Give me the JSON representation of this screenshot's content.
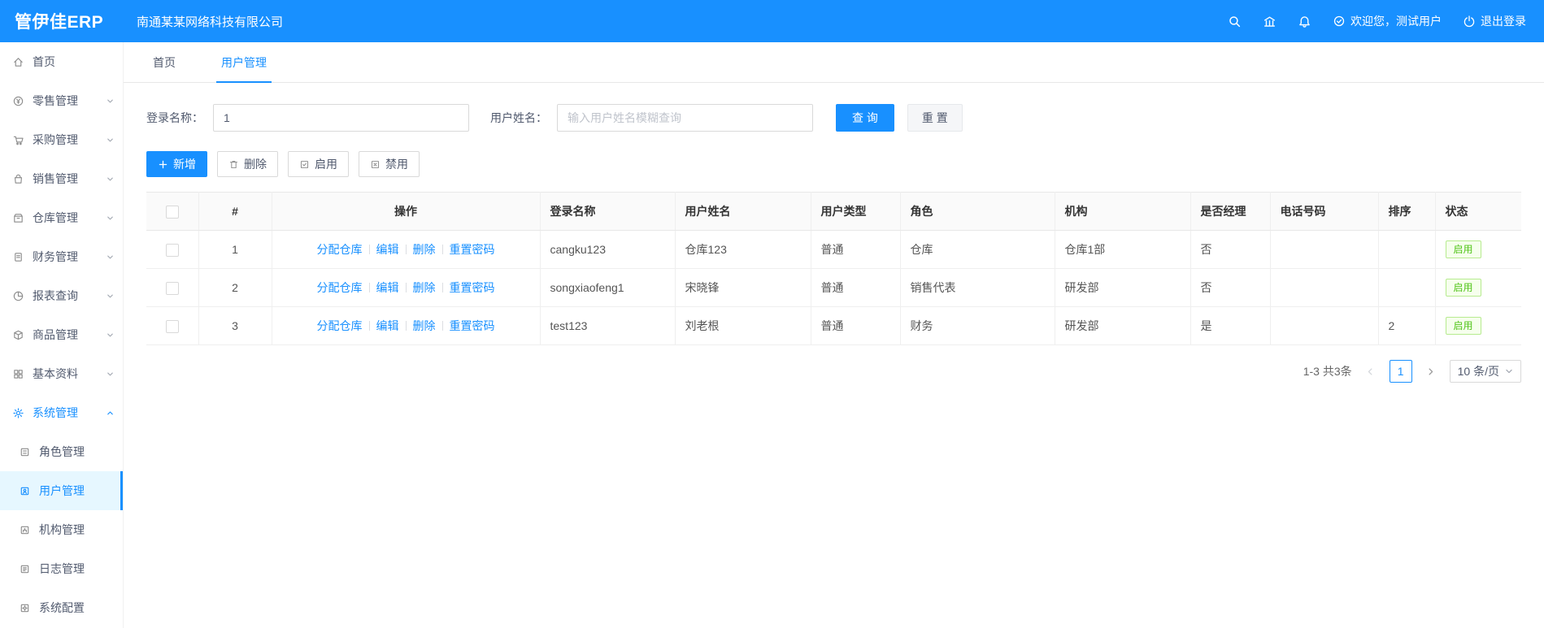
{
  "header": {
    "logo": "管伊佳ERP",
    "company": "南通某某网络科技有限公司",
    "welcome": "欢迎您，测试用户",
    "logout": "退出登录"
  },
  "sidebar": {
    "items": [
      {
        "label": "首页"
      },
      {
        "label": "零售管理"
      },
      {
        "label": "采购管理"
      },
      {
        "label": "销售管理"
      },
      {
        "label": "仓库管理"
      },
      {
        "label": "财务管理"
      },
      {
        "label": "报表查询"
      },
      {
        "label": "商品管理"
      },
      {
        "label": "基本资料"
      },
      {
        "label": "系统管理"
      }
    ],
    "subitems": [
      {
        "label": "角色管理"
      },
      {
        "label": "用户管理"
      },
      {
        "label": "机构管理"
      },
      {
        "label": "日志管理"
      },
      {
        "label": "系统配置"
      }
    ]
  },
  "tabs": [
    {
      "label": "首页"
    },
    {
      "label": "用户管理"
    }
  ],
  "filters": {
    "login_name_label": "登录名称：",
    "login_name_value": "1",
    "user_name_label": "用户姓名：",
    "user_name_placeholder": "输入用户姓名模糊查询",
    "search_button": "查 询",
    "reset_button": "重 置"
  },
  "toolbar": {
    "add": "新增",
    "delete": "删除",
    "enable": "启用",
    "disable": "禁用"
  },
  "table": {
    "columns": [
      "#",
      "操作",
      "登录名称",
      "用户姓名",
      "用户类型",
      "角色",
      "机构",
      "是否经理",
      "电话号码",
      "排序",
      "状态"
    ],
    "action_links": [
      "分配仓库",
      "编辑",
      "删除",
      "重置密码"
    ],
    "rows": [
      {
        "index": "1",
        "login": "cangku123",
        "name": "仓库123",
        "type": "普通",
        "role": "仓库",
        "org": "仓库1部",
        "manager": "否",
        "phone": "",
        "sort": "",
        "status": "启用"
      },
      {
        "index": "2",
        "login": "songxiaofeng1",
        "name": "宋晓锋",
        "type": "普通",
        "role": "销售代表",
        "org": "研发部",
        "manager": "否",
        "phone": "",
        "sort": "",
        "status": "启用"
      },
      {
        "index": "3",
        "login": "test123",
        "name": "刘老根",
        "type": "普通",
        "role": "财务",
        "org": "研发部",
        "manager": "是",
        "phone": "",
        "sort": "2",
        "status": "启用"
      }
    ]
  },
  "pagination": {
    "total": "1-3 共3条",
    "page": "1",
    "page_size": "10 条/页"
  },
  "colors": {
    "primary": "#1890ff",
    "success": "#52c41a"
  }
}
